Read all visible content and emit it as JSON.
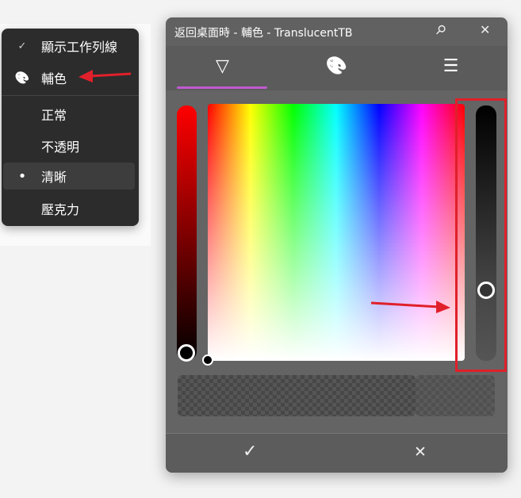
{
  "menu": {
    "items": [
      {
        "label": "顯示工作列線",
        "icon": "check-icon",
        "glyph": "✓"
      },
      {
        "label": "輔色",
        "icon": "palette-icon",
        "glyph": "🎨"
      },
      {
        "label": "正常",
        "icon": "",
        "glyph": ""
      },
      {
        "label": "不透明",
        "icon": "",
        "glyph": ""
      },
      {
        "label": "清晰",
        "icon": "bullet-icon",
        "glyph": "•",
        "selected": true
      },
      {
        "label": "壓克力",
        "icon": "",
        "glyph": ""
      }
    ]
  },
  "dialog": {
    "title": "返回桌面時 - 輔色 - TranslucentTB",
    "pin_glyph": "⚲",
    "close_glyph": "✕",
    "tabs": [
      {
        "name": "color-picker",
        "glyph": "▽"
      },
      {
        "name": "palette",
        "glyph": "🎨"
      },
      {
        "name": "settings",
        "glyph": "☰"
      }
    ],
    "ok_glyph": "✓",
    "cancel_glyph": "✕"
  },
  "colors": {
    "accent": "#c05ad0",
    "annotation": "#e0202a"
  }
}
